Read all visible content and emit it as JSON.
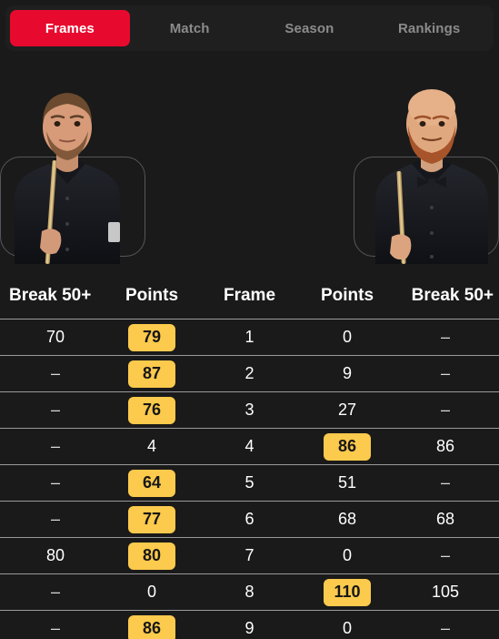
{
  "tabs": [
    {
      "label": "Frames",
      "active": true
    },
    {
      "label": "Match",
      "active": false
    },
    {
      "label": "Season",
      "active": false
    },
    {
      "label": "Rankings",
      "active": false
    }
  ],
  "players": {
    "left": {
      "icon": "player-photo-left",
      "description": "snooker player holding cue, dark shirt, beard"
    },
    "right": {
      "icon": "player-photo-right",
      "description": "bald snooker player with red beard and bow tie holding cue"
    }
  },
  "table": {
    "headers": [
      "Break 50+",
      "Points",
      "Frame",
      "Points",
      "Break 50+"
    ],
    "rows": [
      {
        "left_break": "70",
        "left_points": "79",
        "left_win": true,
        "frame": "1",
        "right_points": "0",
        "right_win": false,
        "right_break": "–"
      },
      {
        "left_break": "–",
        "left_points": "87",
        "left_win": true,
        "frame": "2",
        "right_points": "9",
        "right_win": false,
        "right_break": "–"
      },
      {
        "left_break": "–",
        "left_points": "76",
        "left_win": true,
        "frame": "3",
        "right_points": "27",
        "right_win": false,
        "right_break": "–"
      },
      {
        "left_break": "–",
        "left_points": "4",
        "left_win": false,
        "frame": "4",
        "right_points": "86",
        "right_win": true,
        "right_break": "86"
      },
      {
        "left_break": "–",
        "left_points": "64",
        "left_win": true,
        "frame": "5",
        "right_points": "51",
        "right_win": false,
        "right_break": "–"
      },
      {
        "left_break": "–",
        "left_points": "77",
        "left_win": true,
        "frame": "6",
        "right_points": "68",
        "right_win": false,
        "right_break": "68"
      },
      {
        "left_break": "80",
        "left_points": "80",
        "left_win": true,
        "frame": "7",
        "right_points": "0",
        "right_win": false,
        "right_break": "–"
      },
      {
        "left_break": "–",
        "left_points": "0",
        "left_win": false,
        "frame": "8",
        "right_points": "110",
        "right_win": true,
        "right_break": "105"
      },
      {
        "left_break": "–",
        "left_points": "86",
        "left_win": true,
        "frame": "9",
        "right_points": "0",
        "right_win": false,
        "right_break": "–"
      }
    ]
  },
  "colors": {
    "background": "#1a1a1a",
    "tabbar": "#1f1f1f",
    "accent_red": "#e8092e",
    "badge_yellow": "#fcca4c",
    "divider": "#9a9a9a",
    "inactive_tab_text": "#8b8b8b"
  }
}
